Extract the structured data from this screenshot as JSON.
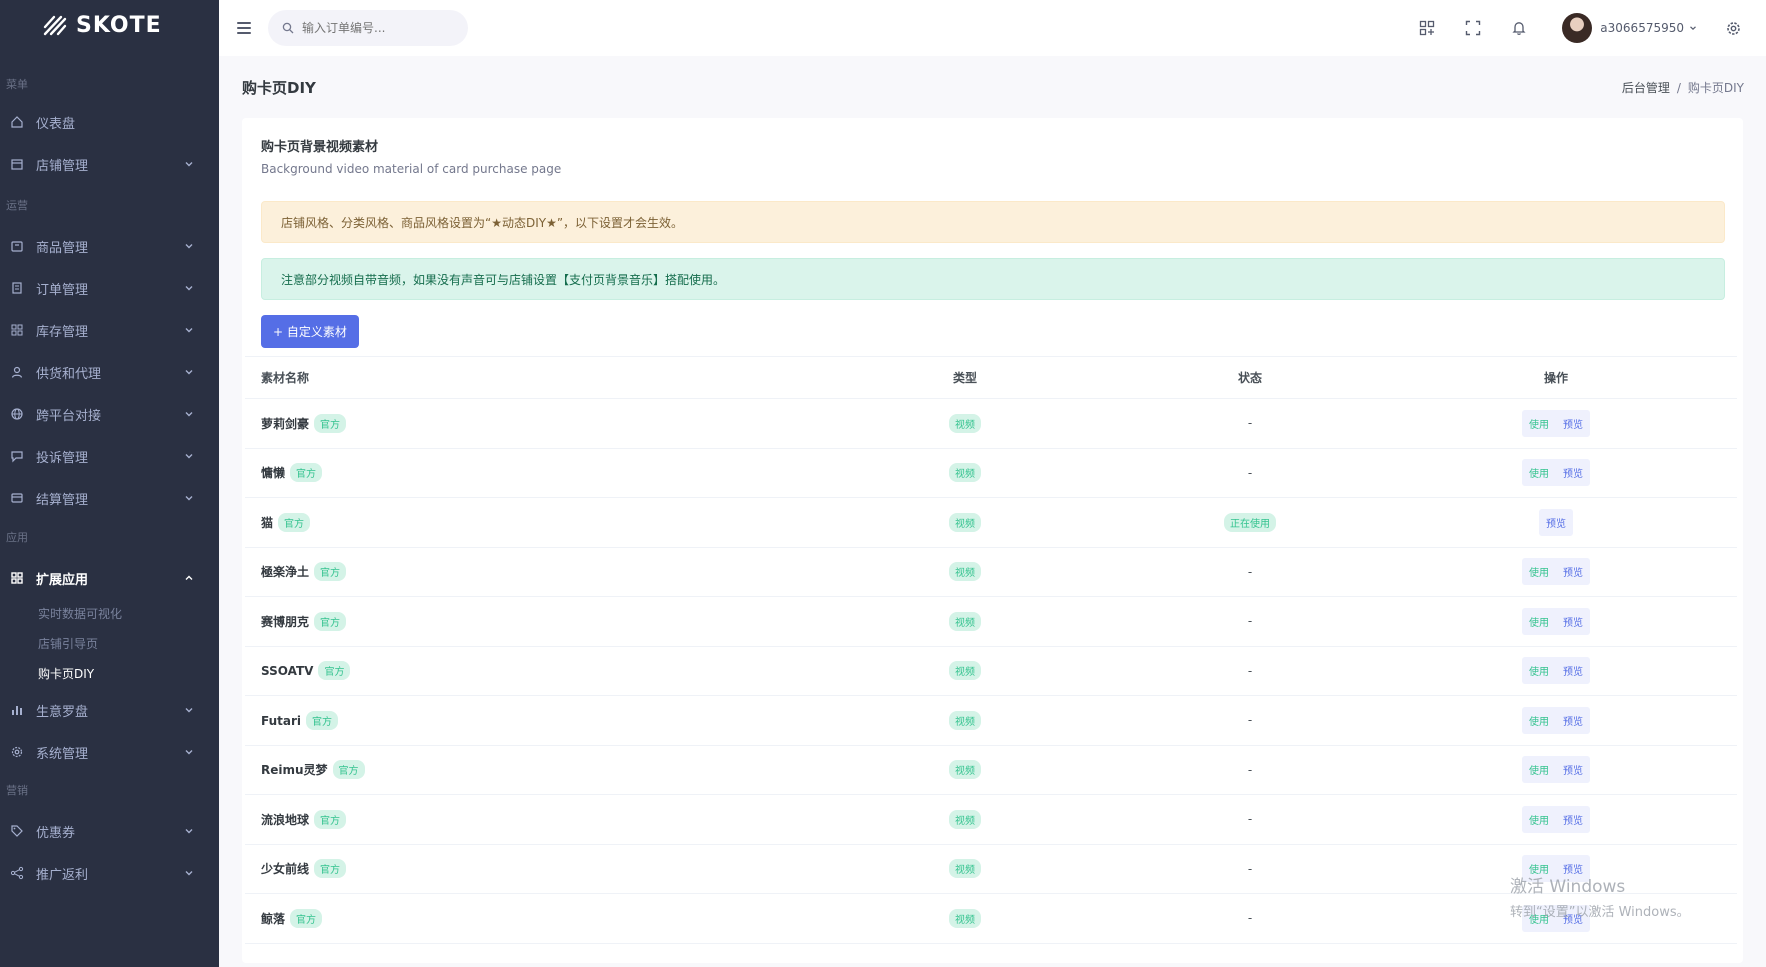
{
  "brand": {
    "name": "SKOTE"
  },
  "sidebar": {
    "sections": {
      "menu": "菜单",
      "ops": "运营",
      "apps": "应用",
      "marketing": "营销"
    },
    "items": {
      "dashboard": "仪表盘",
      "shop": "店铺管理",
      "goods": "商品管理",
      "orders": "订单管理",
      "stock": "库存管理",
      "supply": "供货和代理",
      "cross": "跨平台对接",
      "complaint": "投诉管理",
      "settle": "结算管理",
      "ext": "扩展应用",
      "biz": "生意罗盘",
      "system": "系统管理",
      "coupon": "优惠券",
      "promo": "推广返利"
    },
    "sub": {
      "realtime": "实时数据可视化",
      "guide": "店铺引导页",
      "diy": "购卡页DIY"
    }
  },
  "header": {
    "search_placeholder": "输入订单编号...",
    "username": "a3066575950"
  },
  "page": {
    "title": "购卡页DIY",
    "breadcrumb": {
      "root": "后台管理",
      "sep": "/",
      "current": "购卡页DIY"
    }
  },
  "card": {
    "title": "购卡页背景视频素材",
    "subtitle": "Background video material of card purchase page",
    "alert_warning": "店铺风格、分类风格、商品风格设置为“★动态DIY★”，以下设置才会生效。",
    "alert_info": "注意部分视频自带音频，如果没有声音可与店铺设置【支付页背景音乐】搭配使用。",
    "add_button": "+ 自定义素材"
  },
  "table": {
    "headers": {
      "name": "素材名称",
      "type": "类型",
      "status": "状态",
      "ops": "操作"
    },
    "official_badge": "官方",
    "type_label": "视频",
    "use_label": "使用",
    "preview_label": "预览",
    "rows": [
      {
        "name": "萝莉剑豪",
        "status": "-",
        "in_use": false
      },
      {
        "name": "慵懒",
        "status": "-",
        "in_use": false
      },
      {
        "name": "猫",
        "status": "正在使用",
        "in_use": true
      },
      {
        "name": "極楽浄土",
        "status": "-",
        "in_use": false
      },
      {
        "name": "赛博朋克",
        "status": "-",
        "in_use": false
      },
      {
        "name": "SSOATV",
        "status": "-",
        "in_use": false
      },
      {
        "name": "Futari",
        "status": "-",
        "in_use": false
      },
      {
        "name": "Reimu灵梦",
        "status": "-",
        "in_use": false
      },
      {
        "name": "流浪地球",
        "status": "-",
        "in_use": false
      },
      {
        "name": "少女前线",
        "status": "-",
        "in_use": false
      },
      {
        "name": "鲸落",
        "status": "-",
        "in_use": false
      }
    ]
  },
  "watermark": {
    "line1": "激活 Windows",
    "line2": "转到“设置”以激活 Windows。"
  },
  "colors": {
    "sidebar_bg": "#2a3042",
    "primary": "#556ee6",
    "success": "#34c38f",
    "warning_bg": "#fcf0db",
    "info_bg": "#daf4eb"
  }
}
